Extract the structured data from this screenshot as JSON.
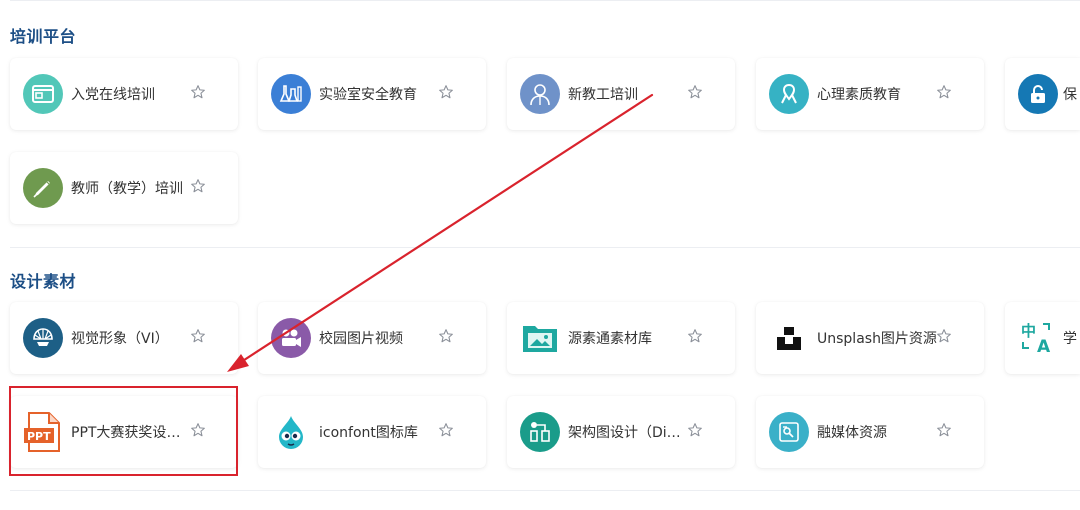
{
  "sections": [
    {
      "title": "培训平台",
      "items": [
        {
          "label": "入党在线培训",
          "icon": "browser-window-icon",
          "color": "#52c7b8"
        },
        {
          "label": "实验室安全教育",
          "icon": "lab-flask-icon",
          "color": "#3b7fd6"
        },
        {
          "label": "新教工培训",
          "icon": "teacher-person-icon",
          "color": "#6f92c9"
        },
        {
          "label": "心理素质教育",
          "icon": "ribbon-icon",
          "color": "#36b2c4"
        },
        {
          "label": "保",
          "icon": "lock-icon",
          "color": "#1578b4"
        },
        {
          "label": "教师（教学）培训",
          "icon": "pen-icon",
          "color": "#6f9a4f"
        }
      ]
    },
    {
      "title": "设计素材",
      "items": [
        {
          "label": "视觉形象（VI）",
          "icon": "shell-emblem-icon",
          "color": "#1d5f86"
        },
        {
          "label": "校园图片视频",
          "icon": "camera-video-icon",
          "color": "#8a5aa8"
        },
        {
          "label": "源素通素材库",
          "icon": "folder-image-icon",
          "color": "#1ea8a0"
        },
        {
          "label": "Unsplash图片资源",
          "icon": "unsplash-logo-icon",
          "color": "#111111"
        },
        {
          "label": "学",
          "icon": "translate-icon",
          "color": "#1ea8a0"
        },
        {
          "label": "PPT大赛获奖设计作品",
          "icon": "ppt-file-icon",
          "color": "#e5622a"
        },
        {
          "label": "iconfont图标库",
          "icon": "iconfont-mascot-icon",
          "color": "#23b7c8"
        },
        {
          "label": "架构图设计（Diagrams）",
          "icon": "architecture-diagram-icon",
          "color": "#1a9c8a"
        },
        {
          "label": "融媒体资源",
          "icon": "media-resource-icon",
          "color": "#3ab0c8"
        }
      ]
    }
  ],
  "colors": {
    "highlight": "#d9232d",
    "title": "#1d4f86",
    "star": "#8a8f98"
  }
}
